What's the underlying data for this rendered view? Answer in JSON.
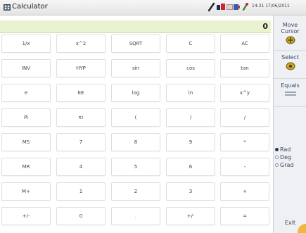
{
  "window": {
    "title": "Calculator",
    "app_icon": "calculator-icon"
  },
  "status_bar": {
    "icons": [
      "wrench-icon",
      "network-icon",
      "battery-icon",
      "plug-icon"
    ],
    "time": "14:31  17/06/2011"
  },
  "display": {
    "value": "0"
  },
  "keypad": {
    "rows": [
      [
        "1/x",
        "x^2",
        "SQRT",
        "C",
        "AC"
      ],
      [
        "INV",
        "HYP",
        "sin",
        "cos",
        "tan"
      ],
      [
        "e",
        "EE",
        "log",
        "ln",
        "x^y"
      ],
      [
        "Pi",
        "n!",
        "(",
        ")",
        "/"
      ],
      [
        "MS",
        "7",
        "8",
        "9",
        "*"
      ],
      [
        "MR",
        "4",
        "5",
        "6",
        "-"
      ],
      [
        "M+",
        "1",
        "2",
        "3",
        "+"
      ],
      [
        "+/-",
        "0",
        ".",
        "+/-",
        "="
      ]
    ]
  },
  "sidebar": {
    "move_cursor": "Move Cursor",
    "move_icon": "cursor-move-icon",
    "select": "Select",
    "select_icon": "select-cursor-icon",
    "equals": "Equals",
    "equals_icon": "equals-icon",
    "exit": "Exit"
  },
  "angle_mode": {
    "options": [
      "Rad",
      "Deg",
      "Grad"
    ],
    "selected": "Rad"
  },
  "colors": {
    "display_bg": "#eaf3cf",
    "sidebar_bg": "#eef0f3",
    "sidebar_text": "#3a4a66",
    "corner_accent": "#f2b63c"
  }
}
